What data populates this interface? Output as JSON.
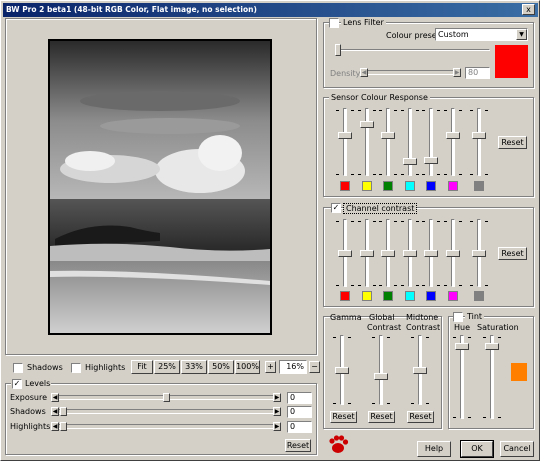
{
  "window": {
    "title": "BW Pro 2 beta1 (48-bit RGB Color, Flat image, no selection)",
    "close_glyph": "x"
  },
  "preview": {
    "shadows_label": "Shadows",
    "highlights_label": "Highlights",
    "zoom_buttons": [
      "Fit",
      "25%",
      "33%",
      "50%",
      "100%"
    ],
    "zoom_value": "16%",
    "plus": "+",
    "minus": "−"
  },
  "levels": {
    "label": "Levels",
    "checked": true,
    "sliders": [
      {
        "label": "Exposure",
        "value": "0",
        "pos": 0.5
      },
      {
        "label": "Shadows",
        "value": "0",
        "pos": 0
      },
      {
        "label": "Highlights",
        "value": "0",
        "pos": 0
      }
    ],
    "reset": "Reset"
  },
  "lens_filter": {
    "label": "Lens Filter",
    "checked": false,
    "preset_label": "Colour preset",
    "preset_value": "Custom",
    "density_label": "Density",
    "density_value": "80",
    "color": "#ff0000"
  },
  "sensor": {
    "title": "Sensor Colour Response",
    "reset": "Reset",
    "levels": [
      0.6,
      0.78,
      0.6,
      0.18,
      0.2,
      0.6,
      0.6
    ],
    "colors": [
      "#ff0000",
      "#ffff00",
      "#008000",
      "#00ffff",
      "#0000ff",
      "#ff00ff",
      "#808080"
    ]
  },
  "channel": {
    "title": "Channel contrast",
    "checked": true,
    "reset": "Reset",
    "levels": [
      0.5,
      0.5,
      0.5,
      0.5,
      0.5,
      0.5,
      0.5
    ],
    "colors": [
      "#ff0000",
      "#ffff00",
      "#008000",
      "#00ffff",
      "#0000ff",
      "#ff00ff",
      "#808080"
    ]
  },
  "tone": {
    "gamma": "Gamma",
    "global_l1": "Global",
    "global_l2": "Contrast",
    "midtone_l1": "Midtone",
    "midtone_l2": "Contrast",
    "reset": "Reset",
    "levels": [
      0.5,
      0.4,
      0.5
    ]
  },
  "tint": {
    "label": "Tint",
    "checked": false,
    "hue": "Hue",
    "saturation": "Saturation",
    "levels": [
      0.9,
      0.9
    ],
    "color": "#ff8000"
  },
  "footer": {
    "help": "Help",
    "ok": "OK",
    "cancel": "Cancel"
  }
}
